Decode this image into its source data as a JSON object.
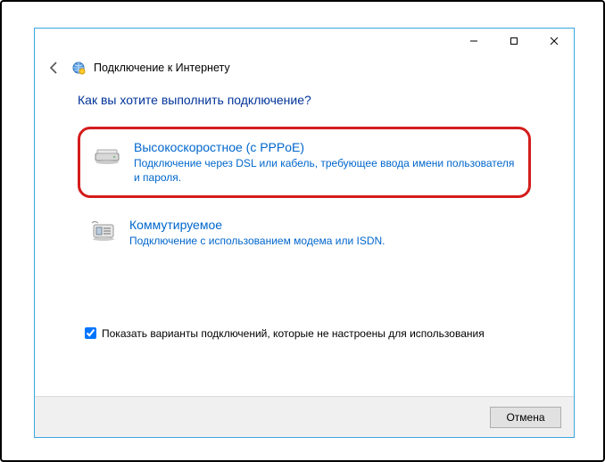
{
  "titlebar": {
    "minimize": "—",
    "maximize": "▢",
    "close": "✕"
  },
  "wizard": {
    "title": "Подключение к Интернету",
    "question": "Как вы хотите выполнить подключение?"
  },
  "options": [
    {
      "title": "Высокоскоростное (с PPPoE)",
      "description": "Подключение через DSL или кабель, требующее ввода имени пользователя и пароля."
    },
    {
      "title": "Коммутируемое",
      "description": "Подключение с использованием модема или ISDN."
    }
  ],
  "checkbox": {
    "label": "Показать варианты подключений, которые не настроены для использования",
    "checked": true
  },
  "footer": {
    "cancel": "Отмена"
  }
}
